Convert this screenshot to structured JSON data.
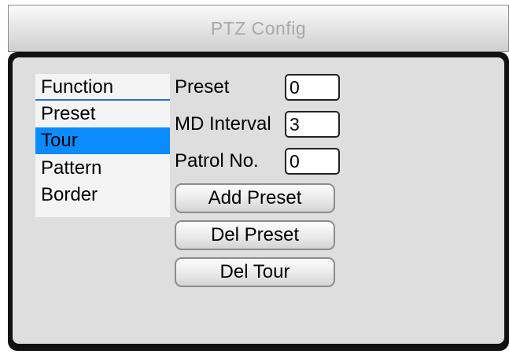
{
  "window": {
    "title": "PTZ Config"
  },
  "menu": {
    "items": [
      {
        "label": "Function",
        "role": "header"
      },
      {
        "label": "Preset"
      },
      {
        "label": "Tour",
        "selected": true
      },
      {
        "label": "Pattern"
      },
      {
        "label": "Border"
      }
    ]
  },
  "form": {
    "preset": {
      "label": "Preset",
      "value": "0"
    },
    "md_interval": {
      "label": "MD Interval",
      "value": "3"
    },
    "patrol_no": {
      "label": "Patrol No.",
      "value": "0"
    }
  },
  "buttons": {
    "add_preset": "Add Preset",
    "del_preset": "Del Preset",
    "del_tour": "Del Tour"
  },
  "colors": {
    "selected_bg": "#0a8cff",
    "panel_border": "#111111",
    "panel_bg": "#dedede"
  }
}
